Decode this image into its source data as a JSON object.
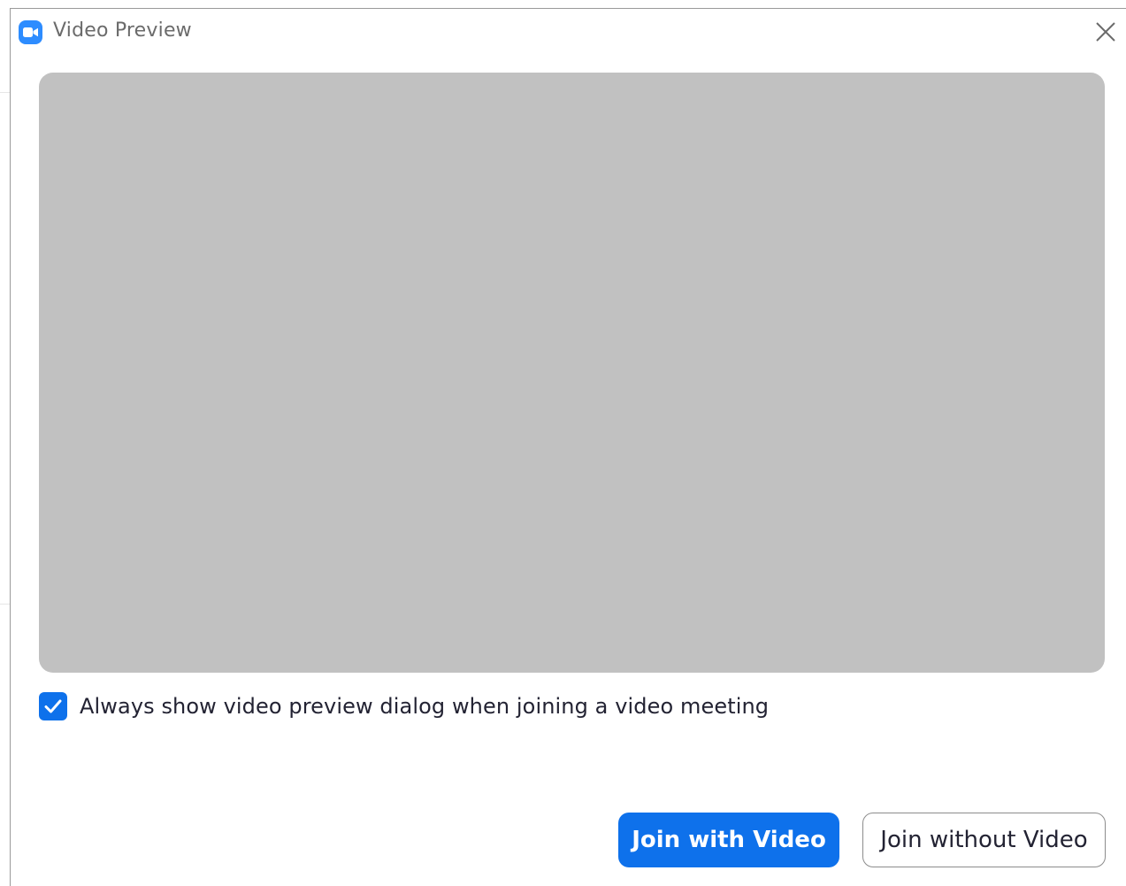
{
  "window": {
    "title": "Video Preview",
    "app_icon": "zoom-camera-icon",
    "close_icon": "close-icon"
  },
  "preview": {
    "state": "no video"
  },
  "options": {
    "always_show_preview_label": "Always show video preview dialog when joining a video meeting",
    "always_show_preview_checked": true
  },
  "buttons": {
    "join_with_video": "Join with Video",
    "join_without_video": "Join without Video"
  },
  "colors": {
    "accent": "#0e71eb",
    "app_icon_bg": "#2d8cff",
    "preview_bg": "#c1c1c1",
    "title_text": "#6b6b6b",
    "body_text": "#232333"
  }
}
